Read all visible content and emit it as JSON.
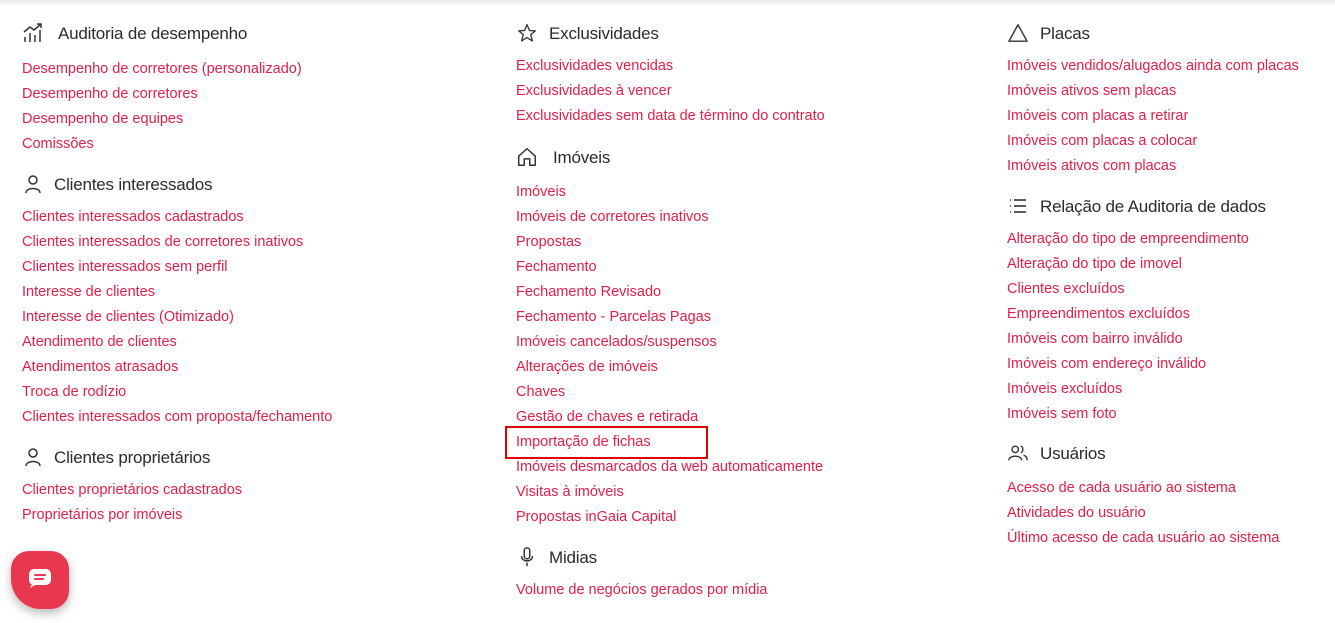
{
  "columns": [
    {
      "sections": [
        {
          "title": "Auditoria de desempenho",
          "icon": "chart-trend-icon",
          "links": [
            "Desempenho de corretores (personalizado)",
            "Desempenho de corretores",
            "Desempenho de equipes",
            "Comissões"
          ]
        },
        {
          "title": "Clientes interessados",
          "icon": "user-icon",
          "links": [
            "Clientes interessados cadastrados",
            "Clientes interessados de corretores inativos",
            "Clientes interessados sem perfil",
            "Interesse de clientes",
            "Interesse de clientes (Otimizado)",
            "Atendimento de clientes",
            "Atendimentos atrasados",
            "Troca de rodízio",
            "Clientes interessados com proposta/fechamento"
          ]
        },
        {
          "title": "Clientes proprietários",
          "icon": "user-icon",
          "links": [
            "Clientes proprietários cadastrados",
            "Proprietários por imóveis"
          ]
        }
      ]
    },
    {
      "sections": [
        {
          "title": "Exclusividades",
          "icon": "star-icon",
          "links": [
            "Exclusividades vencidas",
            "Exclusividades à vencer",
            "Exclusividades sem data de término do contrato"
          ]
        },
        {
          "title": "Imóveis",
          "icon": "home-icon",
          "links": [
            "Imóveis",
            "Imóveis de corretores inativos",
            "Propostas",
            "Fechamento",
            "Fechamento Revisado",
            "Fechamento - Parcelas Pagas",
            "Imóveis cancelados/suspensos",
            "Alterações de imóveis",
            "Chaves",
            "Gestão de chaves e retirada",
            "Importação de fichas",
            "Imóveis desmarcados da web automaticamente",
            "Visitas à imóveis",
            "Propostas inGaia Capital"
          ]
        },
        {
          "title": "Midias",
          "icon": "microphone-icon",
          "links": [
            "Volume de negócios gerados por mídia"
          ]
        }
      ]
    },
    {
      "sections": [
        {
          "title": "Placas",
          "icon": "triangle-icon",
          "links": [
            "Imóveis vendidos/alugados ainda com placas",
            "Imóveis ativos sem placas",
            "Imóveis com placas a retirar",
            "Imóveis com placas a colocar",
            "Imóveis ativos com placas"
          ]
        },
        {
          "title": "Relação de Auditoria de dados",
          "icon": "list-icon",
          "links": [
            "Alteração do tipo de empreendimento",
            "Alteração do tipo de imovel",
            "Clientes excluídos",
            "Empreendimentos excluídos",
            "Imóveis com bairro inválido",
            "Imóveis com endereço inválido",
            "Imóveis excluídos",
            "Imóveis sem foto"
          ]
        },
        {
          "title": "Usuários",
          "icon": "users-icon",
          "links": [
            "Acesso de cada usuário ao sistema",
            "Atividades do usuário",
            "Último acesso de cada usuário ao sistema"
          ]
        }
      ]
    }
  ],
  "highlighted_link": "Importação de fichas",
  "chat_button": {
    "icon": "chat-icon",
    "color": "#e8384f"
  },
  "link_color": "#e0204a"
}
